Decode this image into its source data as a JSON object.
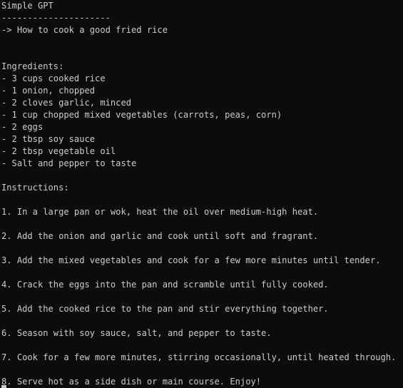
{
  "terminal": {
    "app_title": "Simple GPT",
    "separator": "---------------------",
    "prompt": "-> How to cook a good fried rice",
    "ingredients_header": "Ingredients:",
    "ingredients": [
      "- 3 cups cooked rice",
      "- 1 onion, chopped",
      "- 2 cloves garlic, minced",
      "- 1 cup chopped mixed vegetables (carrots, peas, corn)",
      "- 2 eggs",
      "- 2 tbsp soy sauce",
      "- 2 tbsp vegetable oil",
      "- Salt and pepper to taste"
    ],
    "instructions_header": "Instructions:",
    "instructions": [
      "1. In a large pan or wok, heat the oil over medium-high heat.",
      "2. Add the onion and garlic and cook until soft and fragrant.",
      "3. Add the mixed vegetables and cook for a few more minutes until tender.",
      "4. Crack the eggs into the pan and scramble until fully cooked.",
      "5. Add the cooked rice to the pan and stir everything together.",
      "6. Season with soy sauce, salt, and pepper to taste.",
      "7. Cook for a few more minutes, stirring occasionally, until heated through.",
      "8. Serve hot as a side dish or main course. Enjoy!"
    ]
  }
}
